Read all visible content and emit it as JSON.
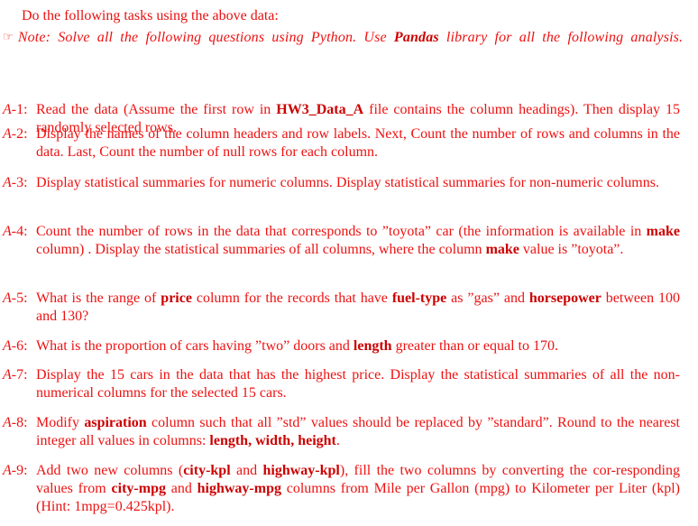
{
  "document": {
    "intro": "Do the following tasks using the above data:",
    "note": {
      "icon": "pointing-hand-icon",
      "icon_glyph": "☞",
      "parts": [
        {
          "text": "Note:  Solve all the following questions using Python.  Use ",
          "bold": false
        },
        {
          "text": "Pandas",
          "bold": true
        },
        {
          "text": " library for all the following analysis.",
          "bold": false
        }
      ]
    },
    "tasks": [
      {
        "prefix": "A",
        "number": "-1:",
        "parts": [
          {
            "text": "Read the data (Assume the first row in ",
            "bold": false
          },
          {
            "text": "HW3_Data_A",
            "bold": true
          },
          {
            "text": " file contains the column headings).  Then display 15 randomly selected rows.",
            "bold": false
          }
        ]
      },
      {
        "prefix": "A",
        "number": "-2:",
        "parts": [
          {
            "text": "Display the names of the column headers and row labels.  Next, Count the number of rows and columns in the data. Last, Count the number of null rows for each column.",
            "bold": false
          }
        ]
      },
      {
        "prefix": "A",
        "number": "-3:",
        "parts": [
          {
            "text": "Display statistical summaries for numeric columns. Display statistical summaries for non-numeric columns.",
            "bold": false
          }
        ]
      },
      {
        "prefix": "A",
        "number": "-4:",
        "parts": [
          {
            "text": "Count the number of rows in the data that corresponds to ”toyota” car (the information is available in ",
            "bold": false
          },
          {
            "text": "make",
            "bold": true
          },
          {
            "text": " column) . Display the statistical summaries of all columns, where the column ",
            "bold": false
          },
          {
            "text": "make",
            "bold": true
          },
          {
            "text": " value is ”toyota”.",
            "bold": false
          }
        ]
      },
      {
        "prefix": "A",
        "number": "-5:",
        "parts": [
          {
            "text": "What is the range of ",
            "bold": false
          },
          {
            "text": "price",
            "bold": true
          },
          {
            "text": " column for the records that have ",
            "bold": false
          },
          {
            "text": "fuel-type",
            "bold": true
          },
          {
            "text": " as ”gas” and ",
            "bold": false
          },
          {
            "text": "horsepower",
            "bold": true
          },
          {
            "text": " between 100 and 130?",
            "bold": false
          }
        ]
      },
      {
        "prefix": "A",
        "number": "-6:",
        "parts": [
          {
            "text": "What is the proportion of cars having ”two” doors and ",
            "bold": false
          },
          {
            "text": "length",
            "bold": true
          },
          {
            "text": " greater than or equal to 170.",
            "bold": false
          }
        ]
      },
      {
        "prefix": "A",
        "number": "-7:",
        "parts": [
          {
            "text": "Display the 15 cars in the data that has the highest price. Display the statistical summaries of all the non-numerical columns for the selected 15 cars.",
            "bold": false
          }
        ]
      },
      {
        "prefix": "A",
        "number": "-8:",
        "parts": [
          {
            "text": "Modify ",
            "bold": false
          },
          {
            "text": "aspiration",
            "bold": true
          },
          {
            "text": " column such that all ”std” values should be replaced by ”standard”. Round to the nearest integer all values in columns: ",
            "bold": false
          },
          {
            "text": "length, width, height",
            "bold": true
          },
          {
            "text": ".",
            "bold": false
          }
        ]
      },
      {
        "prefix": "A",
        "number": "-9:",
        "parts": [
          {
            "text": "Add two new columns (",
            "bold": false
          },
          {
            "text": "city-kpl",
            "bold": true
          },
          {
            "text": " and ",
            "bold": false
          },
          {
            "text": "highway-kpl",
            "bold": true
          },
          {
            "text": "), fill the two columns by converting the cor-­responding values from ",
            "bold": false
          },
          {
            "text": "city-mpg",
            "bold": true
          },
          {
            "text": " and ",
            "bold": false
          },
          {
            "text": "highway-mpg",
            "bold": true
          },
          {
            "text": " columns from Mile per Gallon (mpg) to Kilometer per Liter (kpl) (Hint: 1mpg=0.425kpl).",
            "bold": false
          }
        ]
      }
    ]
  }
}
